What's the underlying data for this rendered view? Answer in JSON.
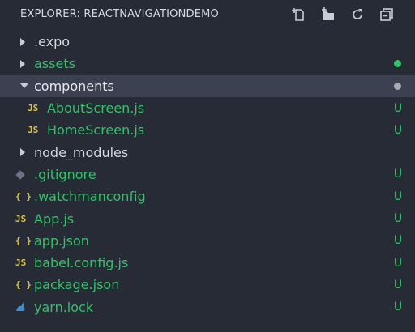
{
  "header": {
    "title": "EXPLORER: REACTNAVIGATIONDEMO"
  },
  "tree": {
    "items": [
      {
        "label": ".expo",
        "status": ""
      },
      {
        "label": "assets",
        "status": ""
      },
      {
        "label": "components",
        "status": ""
      },
      {
        "label": "AboutScreen.js",
        "icon_text": "JS",
        "status": "U"
      },
      {
        "label": "HomeScreen.js",
        "icon_text": "JS",
        "status": "U"
      },
      {
        "label": "node_modules",
        "status": ""
      },
      {
        "label": ".gitignore",
        "status": "U"
      },
      {
        "label": ".watchmanconfig",
        "icon_text": "{ }",
        "status": "U"
      },
      {
        "label": "App.js",
        "icon_text": "JS",
        "status": "U"
      },
      {
        "label": "app.json",
        "icon_text": "{ }",
        "status": "U"
      },
      {
        "label": "babel.config.js",
        "icon_text": "JS",
        "status": "U"
      },
      {
        "label": "package.json",
        "icon_text": "{ }",
        "status": "U"
      },
      {
        "label": "yarn.lock",
        "status": "U"
      }
    ]
  },
  "colors": {
    "background": "#262b35",
    "selected_row": "#3b4150",
    "untracked_green": "#33c26a",
    "js_icon_yellow": "#d8c44a",
    "json_icon_yellow": "#d8c44a",
    "default_text": "#d7dae0",
    "modified_dot_gray": "#a8abb3"
  }
}
